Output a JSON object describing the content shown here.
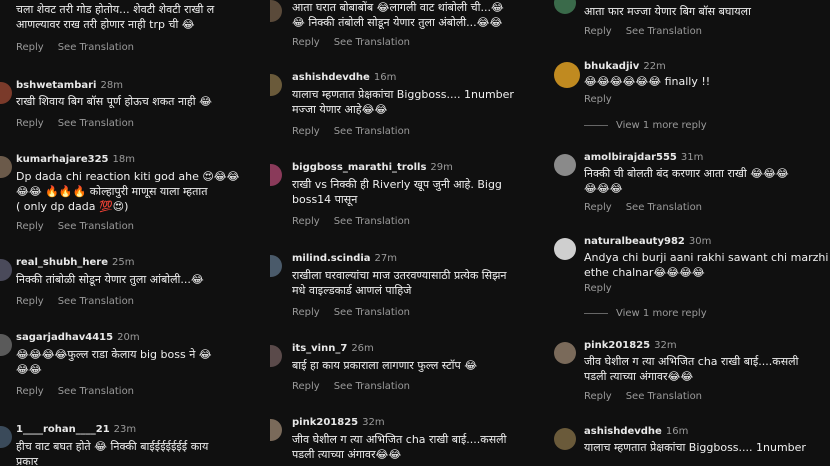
{
  "actions": {
    "reply": "Reply",
    "see_translation": "See Translation"
  },
  "col1": [
    {
      "user": "",
      "time": "",
      "text": "चला शेवट तरी गोड होतोय... शेवटी शेवटी राखी ल\nआणल्यावर राख तरी होणार नाही trp ची 😂",
      "avatar": "#3a3a3a"
    },
    {
      "user": "bshwetambari",
      "time": "28m",
      "text": "राखी शिवाय बिग बॉस पूर्ण होऊच शकत नाही 😂",
      "avatar": "#7a3a2a"
    },
    {
      "user": "kumarhajare325",
      "time": "18m",
      "text": "Dp dada chi reaction kiti god ahe 😍😂😂\n😂😂 🔥🔥🔥 कोल्हापुरी माणूस याला म्हतात\n( only dp dada 💯😍)",
      "avatar": "#6b5a4a"
    },
    {
      "user": "real_shubh_here",
      "time": "25m",
      "text": "निक्की तांबोळी सोडून येणार तुला आंबोली...😂",
      "avatar": "#4a4a5a"
    },
    {
      "user": "sagarjadhav4415",
      "time": "20m",
      "text": "😂😂😂😂फुल्ल राडा केलाय big boss ने 😂\n😂😂",
      "avatar": "#5a5a5a"
    },
    {
      "user": "1____rohan____21",
      "time": "23m",
      "text": "हीच वाट बघत होते 😂 निक्की बाईईईईईईई काय\nप्रकार",
      "avatar": "#3a4a5a"
    }
  ],
  "col2": [
    {
      "user": "",
      "time": "",
      "text": "आता घरात बोबाबोंब 😂लागली वाट थांबोली ची...😂\n😂 निक्की तंबोली सोडून येणार तुला अंबोली...😂😂",
      "avatar": "#5a4a3a"
    },
    {
      "user": "ashishdevdhe",
      "time": "16m",
      "text": "यालाच म्हणतात प्रेक्षकांचा Biggboss.... 1number\nमज्जा येणार आहे😂😂",
      "avatar": "#6a5a3a"
    },
    {
      "user": "biggboss_marathi_trolls",
      "time": "29m",
      "text": "राखी vs निक्की ही Riverly खूप जुनी आहे. Bigg\nboss14 पासून",
      "avatar": "#8a3a5a"
    },
    {
      "user": "milind.scindia",
      "time": "27m",
      "text": "राखीला घरवाल्यांचा  माज उतरवण्यासाठी प्रत्येक सिझन\nमधे वाइल्डकार्ड आणलं पाहिजे",
      "avatar": "#4a5a6a"
    },
    {
      "user": "its_vinn_7",
      "time": "26m",
      "text": "बाई हा काय प्रकाराला लागणार फुल्ल स्टॉप 😂",
      "avatar": "#5a4a4a"
    },
    {
      "user": "pink201825",
      "time": "32m",
      "text": "जीव घेशील ग त्या अभिजित cha राखी बाई....कसली\nपडली त्याच्या अंगावर😂😂",
      "avatar": "#7a6a5a"
    }
  ],
  "col3": [
    {
      "user": "",
      "time": "",
      "text": "आता फार मज्जा येणार बिग बॉस बघायला",
      "avatar": "#3a6a4a"
    },
    {
      "user": "bhukadjiv",
      "time": "22m",
      "text": "😂😂😂😂😂😂 finally !!",
      "avatar": "#c08a20"
    },
    {
      "user": "amolbirajdar555",
      "time": "31m",
      "text": "निक्की ची बोलती बंद करणार आता राखी 😂😂😂\n😂😂😂",
      "avatar": "#8a8a8a"
    },
    {
      "user": "naturalbeauty982",
      "time": "30m",
      "text": "Andya chi burji aani rakhi sawant chi marzhi\nethe chalnar😂😂😂😂",
      "avatar": "#cfcfcf"
    },
    {
      "user": "pink201825",
      "time": "32m",
      "text": "जीव घेशील ग त्या अभिजित cha राखी बाई....कसली\nपडली त्याच्या अंगावर😂😂",
      "avatar": "#7a6a5a"
    },
    {
      "user": "ashishdevdhe",
      "time": "16m",
      "text": "यालाच म्हणतात प्रेक्षकांचा Biggboss.... 1number",
      "avatar": "#6a5a3a"
    }
  ],
  "view_more": "View 1 more reply"
}
